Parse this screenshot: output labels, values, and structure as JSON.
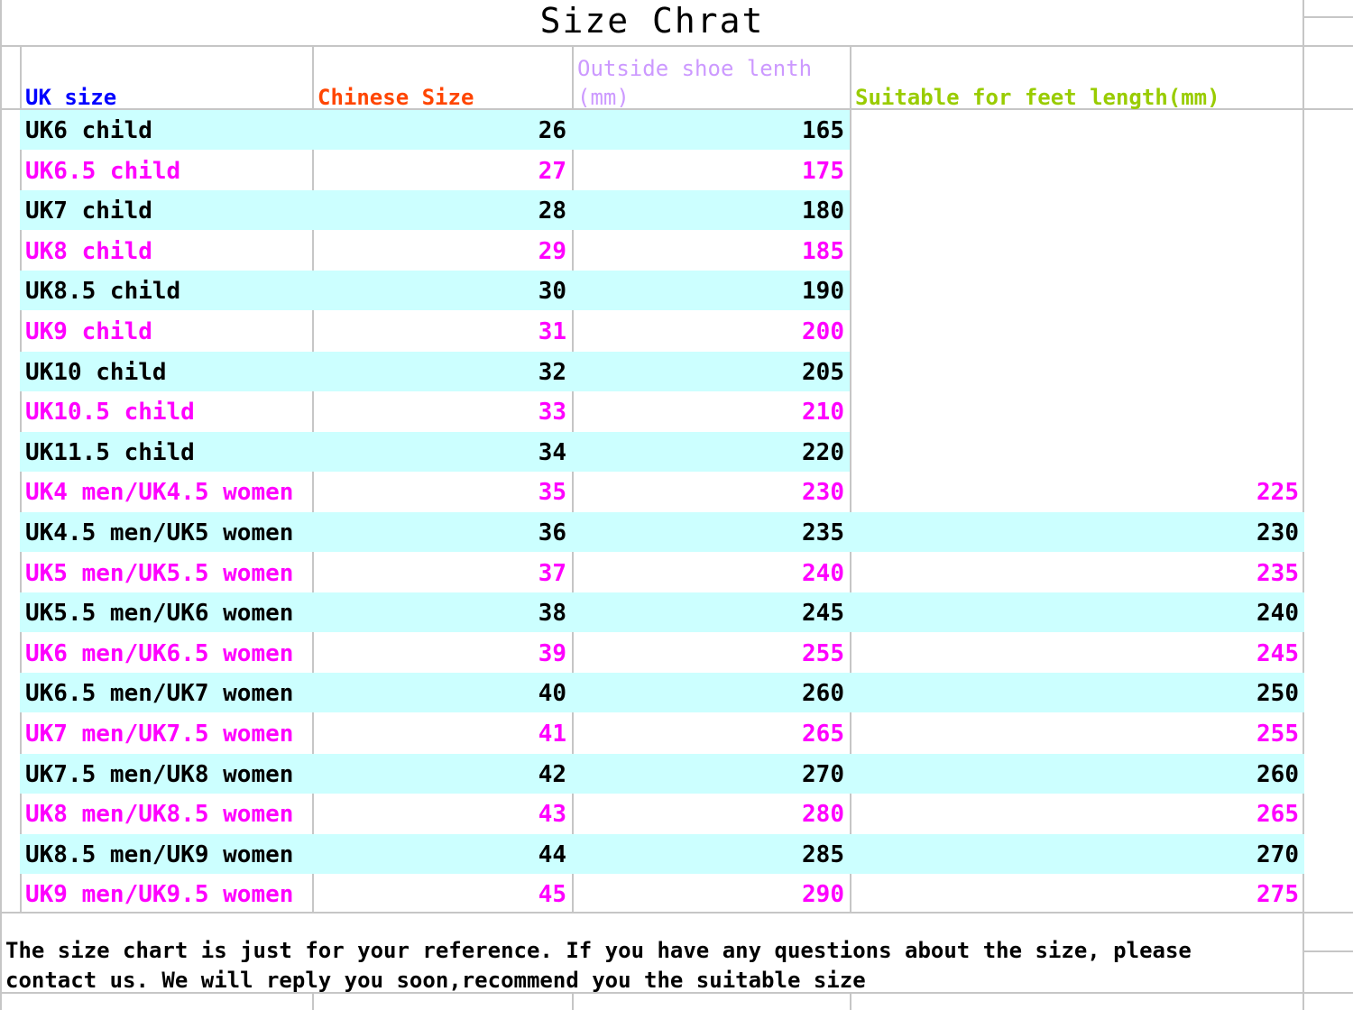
{
  "title": "Size Chrat",
  "columns": {
    "uk_size": "UK size",
    "chinese_size": "Chinese Size",
    "outside_length": "Outside shoe lenth (mm)",
    "feet_length": "Suitable for feet length(mm)"
  },
  "colors": {
    "row_highlight": "#ccffff",
    "alt_text": "#ff00ff",
    "normal_text": "#000000",
    "uk_header": "#0000ff",
    "chinese_header": "#ff4500",
    "outside_header": "#cc99ff",
    "feet_header": "#99cc00",
    "grid": "#c6c6c6"
  },
  "rows": [
    {
      "uk": "UK6 child",
      "cn": "26",
      "out": "165",
      "feet": ""
    },
    {
      "uk": "UK6.5 child",
      "cn": "27",
      "out": "175",
      "feet": ""
    },
    {
      "uk": "UK7 child",
      "cn": "28",
      "out": "180",
      "feet": ""
    },
    {
      "uk": "UK8 child",
      "cn": "29",
      "out": "185",
      "feet": ""
    },
    {
      "uk": "UK8.5 child",
      "cn": "30",
      "out": "190",
      "feet": ""
    },
    {
      "uk": "UK9 child",
      "cn": "31",
      "out": "200",
      "feet": ""
    },
    {
      "uk": "UK10 child",
      "cn": "32",
      "out": "205",
      "feet": ""
    },
    {
      "uk": "UK10.5 child",
      "cn": "33",
      "out": "210",
      "feet": ""
    },
    {
      "uk": "UK11.5 child",
      "cn": "34",
      "out": "220",
      "feet": ""
    },
    {
      "uk": "UK4 men/UK4.5 women",
      "cn": "35",
      "out": "230",
      "feet": "225"
    },
    {
      "uk": "UK4.5 men/UK5 women",
      "cn": "36",
      "out": "235",
      "feet": "230"
    },
    {
      "uk": "UK5 men/UK5.5 women",
      "cn": "37",
      "out": "240",
      "feet": "235"
    },
    {
      "uk": "UK5.5 men/UK6 women",
      "cn": "38",
      "out": "245",
      "feet": "240"
    },
    {
      "uk": "UK6 men/UK6.5 women",
      "cn": "39",
      "out": "255",
      "feet": "245"
    },
    {
      "uk": "UK6.5 men/UK7 women",
      "cn": "40",
      "out": "260",
      "feet": "250"
    },
    {
      "uk": "UK7 men/UK7.5 women",
      "cn": "41",
      "out": "265",
      "feet": "255"
    },
    {
      "uk": "UK7.5 men/UK8 women",
      "cn": "42",
      "out": "270",
      "feet": "260"
    },
    {
      "uk": "UK8 men/UK8.5 women",
      "cn": "43",
      "out": "280",
      "feet": "265"
    },
    {
      "uk": "UK8.5 men/UK9 women",
      "cn": "44",
      "out": "285",
      "feet": "270"
    },
    {
      "uk": "UK9 men/UK9.5 women",
      "cn": "45",
      "out": "290",
      "feet": "275"
    }
  ],
  "note": "The size chart is just for your reference. If you have any questions about the size, please contact us. We will reply you soon,recommend you the suitable size"
}
